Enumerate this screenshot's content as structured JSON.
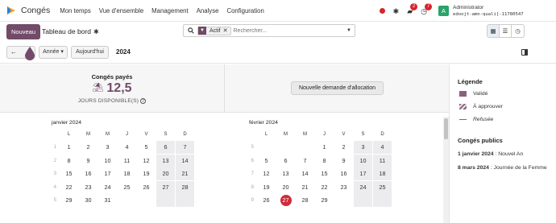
{
  "navbar": {
    "app_name": "Congés",
    "menu": [
      "Mon temps",
      "Vue d'ensemble",
      "Management",
      "Analyse",
      "Configuration"
    ],
    "badges": {
      "chat": "2",
      "activities": "7"
    },
    "avatar_letter": "A",
    "user_name": "Administrator",
    "user_db": "edoojt-amn-quali[-11780547"
  },
  "control_panel": {
    "new_label": "Nouveau",
    "breadcrumb": "Tableau de bord",
    "search_facet": "Actif",
    "search_placeholder": "Rechercher...",
    "scale_label": "Année",
    "today_label": "Aujourd'hui",
    "year": "2024"
  },
  "dashboard": {
    "leave_type": "Congés payés",
    "leave_value": "12,5",
    "leave_caption": "JOURS DISPONIBLE(S)",
    "allocation_button": "Nouvelle demande d'allocation"
  },
  "calendar": {
    "weekdays": [
      "L",
      "M",
      "M",
      "J",
      "V",
      "S",
      "D"
    ],
    "months": [
      {
        "title": "janvier 2024",
        "weeks": [
          {
            "num": "1",
            "days": [
              "1",
              "2",
              "3",
              "4",
              "5",
              "6",
              "7"
            ]
          },
          {
            "num": "2",
            "days": [
              "8",
              "9",
              "10",
              "11",
              "12",
              "13",
              "14"
            ]
          },
          {
            "num": "3",
            "days": [
              "15",
              "16",
              "17",
              "18",
              "19",
              "20",
              "21"
            ]
          },
          {
            "num": "4",
            "days": [
              "22",
              "23",
              "24",
              "25",
              "26",
              "27",
              "28"
            ]
          },
          {
            "num": "5",
            "days": [
              "29",
              "30",
              "31",
              "",
              "",
              "",
              ""
            ]
          }
        ]
      },
      {
        "title": "février 2024",
        "weeks": [
          {
            "num": "5",
            "days": [
              "",
              "",
              "",
              "1",
              "2",
              "3",
              "4"
            ]
          },
          {
            "num": "6",
            "days": [
              "5",
              "6",
              "7",
              "8",
              "9",
              "10",
              "11"
            ]
          },
          {
            "num": "7",
            "days": [
              "12",
              "13",
              "14",
              "15",
              "16",
              "17",
              "18"
            ]
          },
          {
            "num": "8",
            "days": [
              "19",
              "20",
              "21",
              "22",
              "23",
              "24",
              "25"
            ]
          },
          {
            "num": "9",
            "days": [
              "26",
              "27",
              "28",
              "29",
              "",
              "",
              ""
            ]
          }
        ],
        "today": "27"
      }
    ]
  },
  "side_panel": {
    "legend_title": "Légende",
    "legend": {
      "valid": "Validé",
      "to_approve": "À approuver",
      "refused": "Refusée"
    },
    "holidays_title": "Congés publics",
    "holidays": [
      {
        "date": "1 janvier 2024",
        "name": " : Nouvel An"
      },
      {
        "date": "8 mars 2024",
        "name": " : Journée de la Femme"
      }
    ]
  },
  "colors": {
    "brand": "#714b67",
    "today": "#d02c3b",
    "systray_red": "#d9232d"
  }
}
